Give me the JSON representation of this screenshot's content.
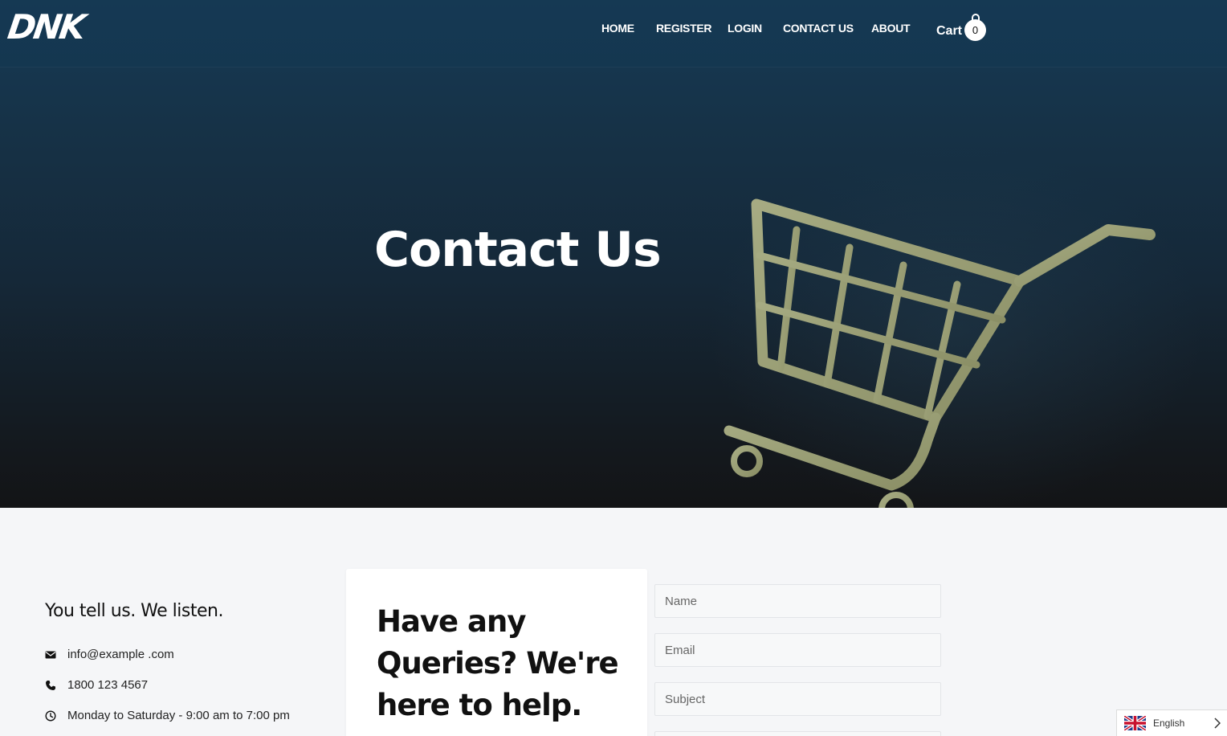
{
  "header": {
    "logo_text": "DNK",
    "nav": [
      {
        "label": "HOME"
      },
      {
        "label": "REGISTER"
      },
      {
        "label": "LOGIN"
      },
      {
        "label": "CONTACT US"
      },
      {
        "label": "ABOUT"
      }
    ],
    "cart_label": "Cart",
    "cart_count": "0"
  },
  "hero": {
    "title": "Contact Us",
    "image": "shopping-cart-illustration"
  },
  "contact_info": {
    "tagline": "You tell us. We listen.",
    "items": [
      {
        "icon": "envelope-icon",
        "text": "info@example .com"
      },
      {
        "icon": "phone-icon",
        "text": "1800 123 4567"
      },
      {
        "icon": "clock-icon",
        "text": "Monday to Saturday - 9:00 am to 7:00 pm"
      }
    ]
  },
  "card": {
    "heading": "Have any Queries? We're here to help."
  },
  "form": {
    "name_placeholder": "Name",
    "email_placeholder": "Email",
    "subject_placeholder": "Subject"
  },
  "language": {
    "label": "English",
    "flag": "uk-flag-icon"
  },
  "colors": {
    "hero_top": "#173a56",
    "hero_bottom": "#131416",
    "cart_art": "#9aa07a",
    "page_bg": "#f5f6f8"
  }
}
